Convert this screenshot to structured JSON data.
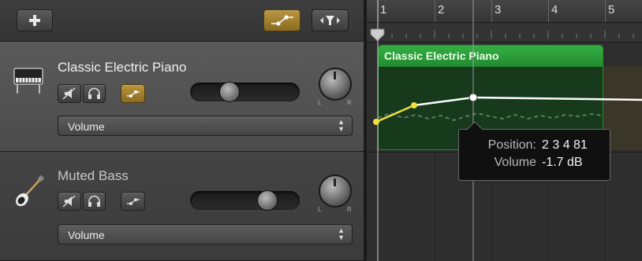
{
  "toolbar": {
    "add_icon": "plus-icon",
    "automation_icon": "automation-curve-icon",
    "filter_icon": "filter-funnel-icon"
  },
  "tracks": [
    {
      "name": "Classic Electric Piano",
      "icon": "electric-piano-icon",
      "automation_param": "Volume",
      "selected": true,
      "volume_level": 0.35
    },
    {
      "name": "Muted Bass",
      "icon": "bass-guitar-icon",
      "automation_param": "Volume",
      "selected": false,
      "volume_level": 0.72
    }
  ],
  "dial_labels": {
    "left": "L",
    "right": "R"
  },
  "ruler": {
    "bars": [
      "1",
      "2",
      "3",
      "4",
      "5"
    ]
  },
  "region": {
    "name": "Classic Electric Piano",
    "color": "#2c9a38"
  },
  "tooltip": {
    "position_label": "Position:",
    "position_value": "2 3 4 81",
    "volume_label": "Volume",
    "volume_value": "-1.7 dB"
  },
  "colors": {
    "accent_on": "#b08a32",
    "region_green": "#2c9a38",
    "automation_line": "#ffffff",
    "automation_active": "#f0e040"
  }
}
